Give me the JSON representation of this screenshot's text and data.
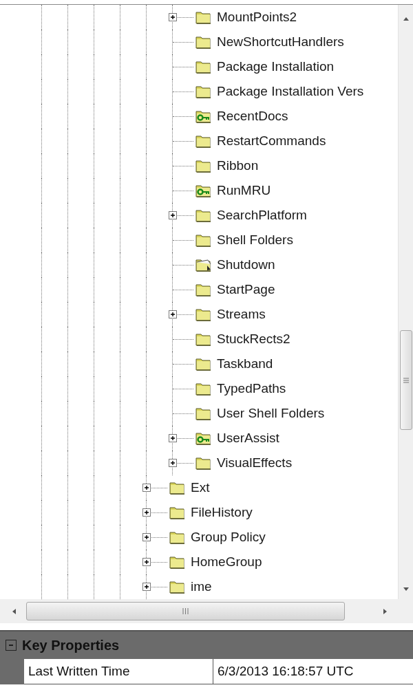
{
  "tree": {
    "items": [
      {
        "children": [
          {
            "label": "MountPoints2",
            "kind": "folder",
            "expandable": true
          },
          {
            "label": "NewShortcutHandlers",
            "kind": "folder",
            "expandable": false
          },
          {
            "label": "Package Installation",
            "kind": "folder",
            "expandable": false
          },
          {
            "label": "Package Installation Vers",
            "kind": "folder",
            "expandable": false
          },
          {
            "label": "RecentDocs",
            "kind": "key",
            "expandable": false
          },
          {
            "label": "RestartCommands",
            "kind": "folder",
            "expandable": false
          },
          {
            "label": "Ribbon",
            "kind": "folder",
            "expandable": false
          },
          {
            "label": "RunMRU",
            "kind": "key",
            "expandable": false
          },
          {
            "label": "SearchPlatform",
            "kind": "folder",
            "expandable": true
          },
          {
            "label": "Shell Folders",
            "kind": "folder",
            "expandable": false
          },
          {
            "label": "Shutdown",
            "kind": "shortcut",
            "expandable": false
          },
          {
            "label": "StartPage",
            "kind": "folder",
            "expandable": false
          },
          {
            "label": "Streams",
            "kind": "folder",
            "expandable": true
          },
          {
            "label": "StuckRects2",
            "kind": "folder",
            "expandable": false
          },
          {
            "label": "Taskband",
            "kind": "folder",
            "expandable": false
          },
          {
            "label": "TypedPaths",
            "kind": "folder",
            "expandable": false
          },
          {
            "label": "User Shell Folders",
            "kind": "folder",
            "expandable": false
          },
          {
            "label": "UserAssist",
            "kind": "key",
            "expandable": true
          },
          {
            "label": "VisualEffects",
            "kind": "folder",
            "expandable": true
          }
        ]
      },
      {
        "label": "Ext",
        "kind": "folder",
        "expandable": true
      },
      {
        "label": "FileHistory",
        "kind": "folder",
        "expandable": true
      },
      {
        "label": "Group Policy",
        "kind": "folder",
        "expandable": true
      },
      {
        "label": "HomeGroup",
        "kind": "folder",
        "expandable": true
      },
      {
        "label": "ime",
        "kind": "folder",
        "expandable": true
      }
    ]
  },
  "properties": {
    "title": "Key Properties",
    "expanded": true,
    "rows": [
      {
        "name": "Last Written Time",
        "value": "6/3/2013 16:18:57 UTC"
      }
    ]
  }
}
